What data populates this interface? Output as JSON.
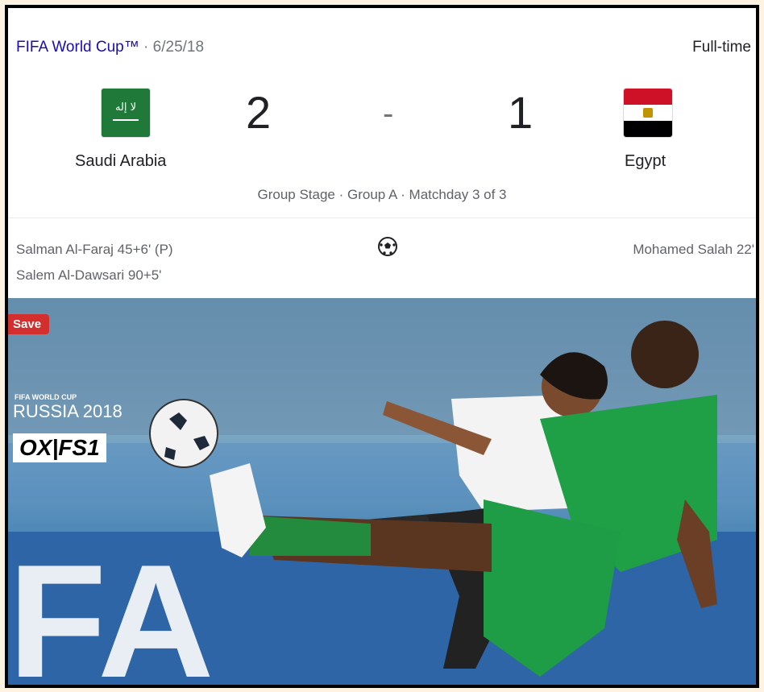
{
  "match": {
    "competition": "FIFA World Cup™",
    "date": "· 6/25/18",
    "status": "Full-time",
    "home": {
      "team": "Saudi Arabia",
      "score": "2",
      "flag_color": "#1f7a3a"
    },
    "away": {
      "team": "Egypt",
      "score": "1",
      "flag_colors": [
        "#ce1126",
        "#ffffff",
        "#000000"
      ]
    },
    "separator": "-",
    "stage": "Group Stage · Group A · Matchday 3 of 3",
    "home_scorers": [
      "Salman Al-Faraj 45+6' (P)",
      "Salem Al-Dawsari 90+5'"
    ],
    "away_scorers": [
      "Mohamed Salah 22'"
    ],
    "goal_icon": "soccer-ball-icon"
  },
  "media": {
    "save_label": "Save",
    "wc_logo_small": "FIFA WORLD CUP",
    "wc_logo_big": "RUSSIA 2018",
    "tv_logo": "OX|FS1",
    "watermark": "FA"
  }
}
